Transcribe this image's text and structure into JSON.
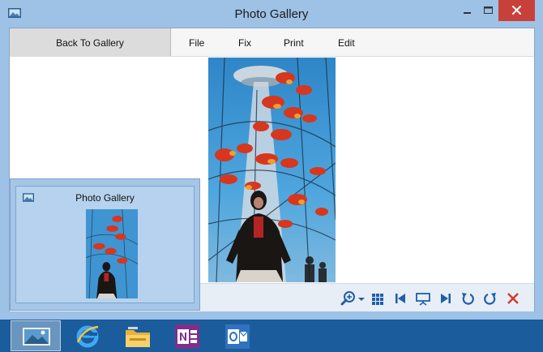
{
  "window": {
    "title": "Photo Gallery"
  },
  "menubar": {
    "back_label": "Back To Gallery",
    "items": [
      "File",
      "Fix",
      "Print",
      "Edit"
    ]
  },
  "preview": {
    "title": "Photo Gallery"
  },
  "toolbar": {
    "icons": [
      "zoom-icon",
      "dropdown-arrow-icon",
      "grid-icon",
      "previous-icon",
      "slideshow-icon",
      "next-icon",
      "rotate-left-icon",
      "rotate-right-icon",
      "delete-icon"
    ]
  },
  "taskbar": {
    "apps": [
      "photo-gallery-icon",
      "internet-explorer-icon",
      "file-explorer-icon",
      "onenote-icon",
      "outlook-icon"
    ]
  },
  "colors": {
    "window_frame": "#9ec1e6",
    "close_button": "#c7413a",
    "taskbar": "#1b5c9c",
    "toolbar_icon": "#1f5fa8",
    "delete_icon": "#d23a2e"
  }
}
